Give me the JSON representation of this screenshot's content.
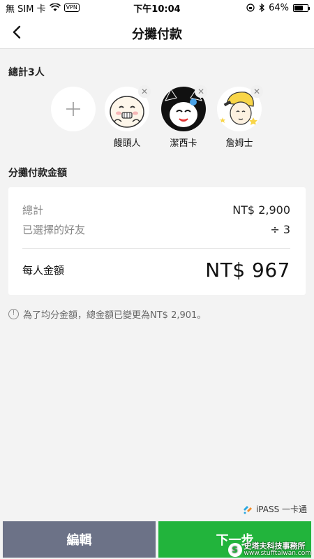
{
  "status_bar": {
    "carrier": "無 SIM 卡",
    "vpn": "VPN",
    "time": "下午10:04",
    "battery": "64%",
    "battery_level": 0.64
  },
  "header": {
    "title": "分攤付款"
  },
  "friends": {
    "total_label": "總計3人",
    "items": [
      {
        "name": "饅頭人"
      },
      {
        "name": "潔西卡"
      },
      {
        "name": "詹姆士"
      }
    ]
  },
  "amount": {
    "section_label": "分攤付款金額",
    "total_label": "總計",
    "total_value": "NT$ 2,900",
    "selected_label": "已選擇的好友",
    "selected_value": "÷ 3",
    "per_person_label": "每人金額",
    "per_person_value": "NT$ 967"
  },
  "notice": "為了均分金額，總金額已變更為NT$ 2,901。",
  "branding": {
    "ipass": "iPASS 一卡通"
  },
  "buttons": {
    "edit": "編輯",
    "next": "下一步"
  },
  "watermark": {
    "logo": "S",
    "name": "史塔夫科技事務所",
    "url": "www.stufftaiwan.com"
  }
}
